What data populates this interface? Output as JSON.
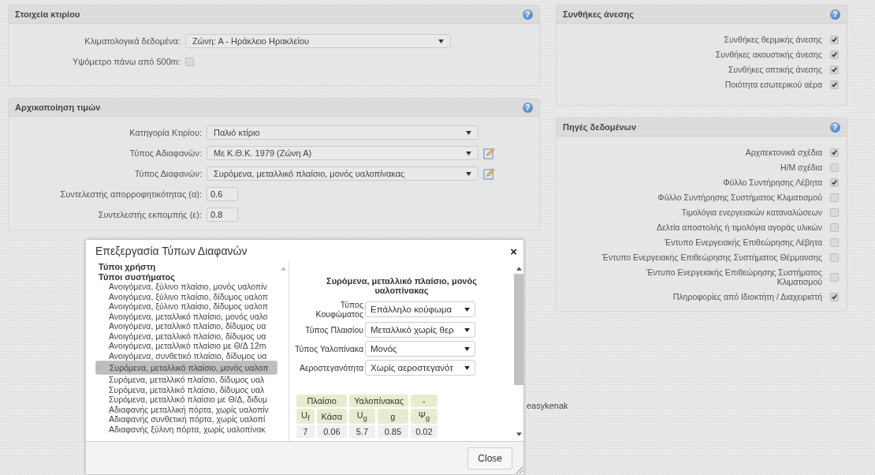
{
  "building_panel": {
    "title": "Στοιχεία κτιρίου",
    "help": "?",
    "fields": [
      {
        "kind": "select",
        "label": "Κλιματολογικά δεδομένα:",
        "value": "Ζώνη: Α - Ηράκλειο Ηρακλείου",
        "editable": false
      },
      {
        "kind": "checkbox",
        "label": "Υψόμετρο πάνω από 500m:",
        "checked": false
      }
    ]
  },
  "init_panel": {
    "title": "Αρχικοποίηση τιμών",
    "help": "?",
    "fields": [
      {
        "kind": "select",
        "label": "Κατηγορία Κτιρίου:",
        "value": "Παλιό κτίριο",
        "editable": false
      },
      {
        "kind": "select",
        "label": "Τύπος Αδιαφανών:",
        "value": "Με Κ.Θ.Κ. 1979 (Ζώνη Α)",
        "editable": true
      },
      {
        "kind": "select",
        "label": "Τύπος Διαφανών:",
        "value": "Συρόμενα, μεταλλικό πλαίσιο, μονός υαλοπίνακας",
        "editable": true
      },
      {
        "kind": "input",
        "label": "Συντελεστής απορροφητικότητας (α):",
        "value": "0.6"
      },
      {
        "kind": "input",
        "label": "Συντελεστής εκπομπής (ε):",
        "value": "0.8"
      }
    ]
  },
  "comfort_panel": {
    "title": "Συνθήκες άνεσης",
    "help": "?",
    "items": [
      {
        "label": "Συνθήκες θερμικής άνεσης",
        "checked": true
      },
      {
        "label": "Συνθήκες ακουστικής άνεσης",
        "checked": true
      },
      {
        "label": "Συνθήκες οπτικής άνεσης",
        "checked": true
      },
      {
        "label": "Ποιότητα εσωτερικού αέρα",
        "checked": true
      }
    ]
  },
  "sources_panel": {
    "title": "Πηγές δεδομένων",
    "help": "?",
    "items": [
      {
        "label": "Αρχιτεκτονικά σχέδια",
        "checked": true
      },
      {
        "label": "Η/Μ σχέδια",
        "checked": false
      },
      {
        "label": "Φύλλο Συντήρησης Λέβητα",
        "checked": true
      },
      {
        "label": "Φύλλο Συντήρησης Συστήματος Κλιματισμού",
        "checked": false
      },
      {
        "label": "Τιμολόγια ενεργειακών καταναλώσεων",
        "checked": false
      },
      {
        "label": "Δελτία αποστολής ή τιμολόγια αγοράς υλικών",
        "checked": false
      },
      {
        "label": "Έντυπο Ενεργειακής Επιθεώρησης Λέβητα",
        "checked": false
      },
      {
        "label": "Έντυπο Ενεργειακής Επιθεώρησης Συστήματος Θέρμανσης",
        "checked": false
      },
      {
        "label": "Έντυπο Ενεργειακής Επιθεώρησης Συστήματος Κλιματισμού",
        "checked": false
      },
      {
        "label": "Πληροφορίες από Ιδιοκτήτη / Διαχειριστή",
        "checked": true
      }
    ]
  },
  "footer_text": "easykenak",
  "dialog": {
    "title": "Επεξεργασία Τύπων Διαφανών",
    "close": "×",
    "tree": [
      {
        "label": "Τύποι χρήστη",
        "selected": false
      },
      {
        "label": "Τύποι συστήματος",
        "selected": false,
        "children": [
          {
            "label": "Ανοιγόμενα, ξύλινο πλαίσιο, μονός υαλοπίν",
            "selected": false
          },
          {
            "label": "Ανοιγόμενα, ξύλινο πλαίσιο, δίδυμος υαλοπ",
            "selected": false
          },
          {
            "label": "Ανοιγόμενα, ξύλινο πλαίσιο, δίδυμος υαλοπ",
            "selected": false
          },
          {
            "label": "Ανοιγόμενα, μεταλλικό πλαίσιο, μονός υαλο",
            "selected": false
          },
          {
            "label": "Ανοιγόμενα, μεταλλικό πλαίσιο, δίδυμος υα",
            "selected": false
          },
          {
            "label": "Ανοιγόμενα, μεταλλικό πλαίσιο, δίδυμος υα",
            "selected": false
          },
          {
            "label": "Ανοιγόμενα, μεταλλικό πλαίσιο με Θ/Δ 12m",
            "selected": false
          },
          {
            "label": "Ανοιγόμενα, συνθετικό πλαίσιο, δίδυμος υα",
            "selected": false
          },
          {
            "label": "Συρόμενα, μεταλλικό πλαίσιο, μονός υαλοπ",
            "selected": true
          },
          {
            "label": "Συρόμενα, μεταλλικό πλαίσιο, δίδυμος υαλ",
            "selected": false
          },
          {
            "label": "Συρόμενα, μεταλλικό πλαίσιο, δίδυμος υαλ",
            "selected": false
          },
          {
            "label": "Συρόμενα, μεταλλικό πλαίσιο με Θ/Δ, διδυμ",
            "selected": false
          },
          {
            "label": "Αδιαφανής μεταλλική πόρτα, χωρίς υαλοπίν",
            "selected": false
          },
          {
            "label": "Αδιαφανής συνθετική πόρτα, χωρίς υαλοπί",
            "selected": false
          },
          {
            "label": "Αδιαφανής ξύλινη πόρτα, χωρίς υαλοπίνακ",
            "selected": false
          }
        ]
      }
    ],
    "detail": {
      "heading": "Συρόμενα, μεταλλικό πλαίσιο, μονός υαλοπίνακας",
      "fields": [
        {
          "label": "Τύπος Κουφώματος",
          "value": "Επάλληλο κούφωμα"
        },
        {
          "label": "Τύπος Πλαισίου",
          "value": "Μεταλλικό χωρίς θερ"
        },
        {
          "label": "Τύπος Υαλοπίνακα",
          "value": "Μονός"
        },
        {
          "label": "Αεροστεγανότητα",
          "value": "Χωρίς αεροστεγανότ"
        }
      ],
      "table": {
        "groups": [
          "Πλαίσιο",
          "Υαλοπίνακας",
          "-"
        ],
        "columns": [
          "U$_{f}$",
          "Κάσα",
          "U$_{g}$",
          "g",
          "Ψ$_{g}$"
        ],
        "rows": [
          [
            "7",
            "0.06",
            "5.7",
            "0.85",
            "0.02"
          ]
        ]
      }
    },
    "close_button": "Close"
  }
}
